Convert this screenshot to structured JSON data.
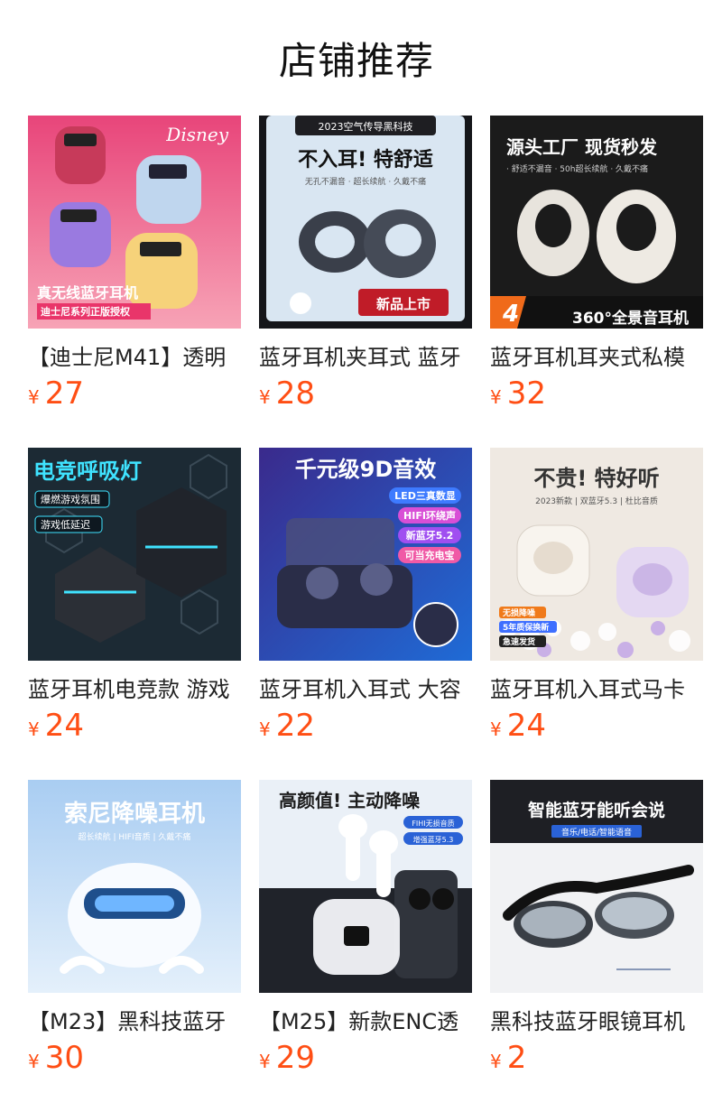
{
  "page": {
    "title": "店铺推荐"
  },
  "products": [
    {
      "name": "【迪士尼M41】透明",
      "currency": "¥",
      "price": "27",
      "image": {
        "headline": "真无线蓝牙耳机",
        "sub": "迪士尼系列正版授权",
        "brand": "Disney",
        "bg": "#e8457a"
      }
    },
    {
      "name": "蓝牙耳机夹耳式 蓝牙",
      "currency": "¥",
      "price": "28",
      "image": {
        "top": "2023空气传导黑科技",
        "headline": "不入耳! 特舒适",
        "sub": "无孔不漏音 · 超长续航 · 久戴不痛",
        "badge": "新品上市",
        "bg": "#d9e6f2"
      }
    },
    {
      "name": "蓝牙耳机耳夹式私模",
      "currency": "¥",
      "price": "32",
      "image": {
        "headline": "源头工厂 现货秒发",
        "sub": "· 舒适不漏音 · 50h超长续航 · 久戴不痛",
        "badge": "360°全景音耳机",
        "bg": "#1b1b1b"
      }
    },
    {
      "name": "蓝牙耳机电竞款 游戏",
      "currency": "¥",
      "price": "24",
      "image": {
        "headline": "电竞呼吸灯",
        "tag1": "爆燃游戏氛围",
        "tag2": "游戏低延迟",
        "bg": "#1c2a34"
      }
    },
    {
      "name": "蓝牙耳机入耳式 大容",
      "currency": "¥",
      "price": "22",
      "image": {
        "headline": "千元级9D音效",
        "tags": [
          "LED三真数显",
          "HIFI环绕声",
          "新蓝牙5.2",
          "可当充电宝"
        ],
        "bg": "#2a3a8c"
      }
    },
    {
      "name": "蓝牙耳机入耳式马卡",
      "currency": "¥",
      "price": "24",
      "image": {
        "headline": "不贵! 特好听",
        "sub": "2023新款 | 双蓝牙5.3 | 杜比音质",
        "tags": [
          "无损降噪",
          "5年质保换新",
          "急速发货"
        ],
        "bg": "#efe9e2"
      }
    },
    {
      "name": "【M23】黑科技蓝牙",
      "currency": "¥",
      "price": "30",
      "image": {
        "headline": "索尼降噪耳机",
        "sub": "超长续航 | HIFI音质 | 久戴不痛",
        "bg": "#cfe3f6"
      }
    },
    {
      "name": "【M25】新款ENC透",
      "currency": "¥",
      "price": "29",
      "image": {
        "headline": "高颜值! 主动降噪",
        "tags": [
          "FIHI无损音质",
          "增强蓝牙5.3"
        ],
        "bg": "#eaf0f7"
      }
    },
    {
      "name": "黑科技蓝牙眼镜耳机",
      "currency": "¥",
      "price": "2",
      "image": {
        "headline": "智能蓝牙能听会说",
        "sub": "音乐/电话/智能语音",
        "bg": "#f1f2f4"
      }
    }
  ]
}
